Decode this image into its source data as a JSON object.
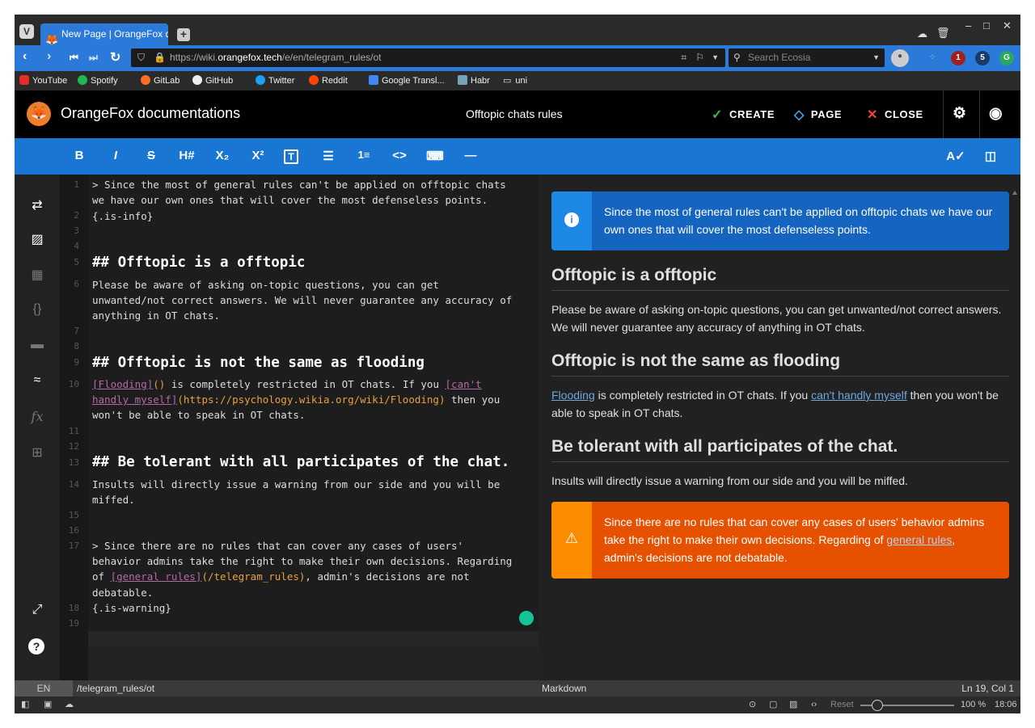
{
  "browser": {
    "tab_title": "New Page | OrangeFox d",
    "url_prefix": "https://wiki.",
    "url_domain": "orangefox.tech",
    "url_path": "/e/en/telegram_rules/ot",
    "search_placeholder": "Search Ecosia",
    "bookmarks": [
      "YouTube",
      "Spotify",
      "GitLab",
      "GitHub",
      "Twitter",
      "Reddit",
      "Google Transl...",
      "Habr",
      "uni"
    ],
    "ext_badges": [
      "1",
      "5"
    ],
    "zoom": "100 %",
    "reset_label": "Reset",
    "time": "18:06"
  },
  "app": {
    "title": "OrangeFox documentations",
    "page_title": "Offtopic chats rules",
    "create_label": "CREATE",
    "page_label": "PAGE",
    "close_label": "CLOSE"
  },
  "toolbar": [
    "B",
    "I",
    "S",
    "H#",
    "X₂",
    "X²",
    "T",
    "☰",
    "1≡",
    "<>",
    "⌨",
    "—"
  ],
  "editor": {
    "line_numbers": [
      "1",
      "2",
      "3",
      "4",
      "5",
      "6",
      "7",
      "8",
      "9",
      "10",
      "11",
      "12",
      "13",
      "14",
      "15",
      "16",
      "17",
      "18",
      "19"
    ],
    "l1a": "> Since the most of general rules can't be applied on offtopic chats",
    "l1b": "we have our own ones that will cover the most defenseless points.",
    "l2": "{.is-info}",
    "l5": "## Offtopic is a offtopic",
    "l6a": "Please be aware of asking on-topic questions, you can get",
    "l6b": "unwanted/not correct answers. We will never guarantee any accuracy of",
    "l6c": "anything in OT chats.",
    "l9": "## Offtopic is not the same as flooding",
    "l10a_link": "[Flooding]",
    "l10a_paren": "()",
    "l10a_text": " is completely restricted in OT chats. If you ",
    "l10a_link2": "[can't",
    "l10b_link": "handly myself]",
    "l10b_url": "(https://psychology.wikia.org/wiki/Flooding)",
    "l10b_text": " then you",
    "l10c": "won't be able to speak in OT chats.",
    "l13": "## Be tolerant with all participates of the chat.",
    "l14a": "Insults will directly issue a warning from our side and you will be",
    "l14b": "miffed.",
    "l17a": "> Since there are no rules that can cover any cases of users'",
    "l17b": "behavior admins take the right to make their own decisions. Regarding",
    "l17c_pre": "of ",
    "l17c_link": "[general rules]",
    "l17c_url": "(/telegram_rules)",
    "l17c_post": ", admin's decisions are not",
    "l17d": "debatable.",
    "l18": "{.is-warning}"
  },
  "preview": {
    "info": "Since the most of general rules can't be applied on offtopic chats we have our own ones that will cover the most defenseless points.",
    "h1": "Offtopic is a offtopic",
    "p1": "Please be aware of asking on-topic questions, you can get unwanted/not correct answers. We will never guarantee any accuracy of anything in OT chats.",
    "h2": "Offtopic is not the same as flooding",
    "p2_link1": "Flooding",
    "p2_mid": " is completely restricted in OT chats. If you ",
    "p2_link2": "can't handly myself",
    "p2_end": " then you won't be able to speak in OT chats.",
    "h3": "Be tolerant with all participates of the chat.",
    "p3": "Insults will directly issue a warning from our side and you will be miffed.",
    "warn_pre": "Since there are no rules that can cover any cases of users' behavior admins take the right to make their own decisions. Regarding of ",
    "warn_link": "general rules",
    "warn_post": ", admin's decisions are not debatable."
  },
  "status": {
    "lang": "EN",
    "path": "/telegram_rules/ot",
    "mode": "Markdown",
    "cursor": "Ln 19, Col 1"
  },
  "colors": {
    "accent": "#1976d2",
    "info": "#1565c0",
    "warning": "#e65100"
  }
}
